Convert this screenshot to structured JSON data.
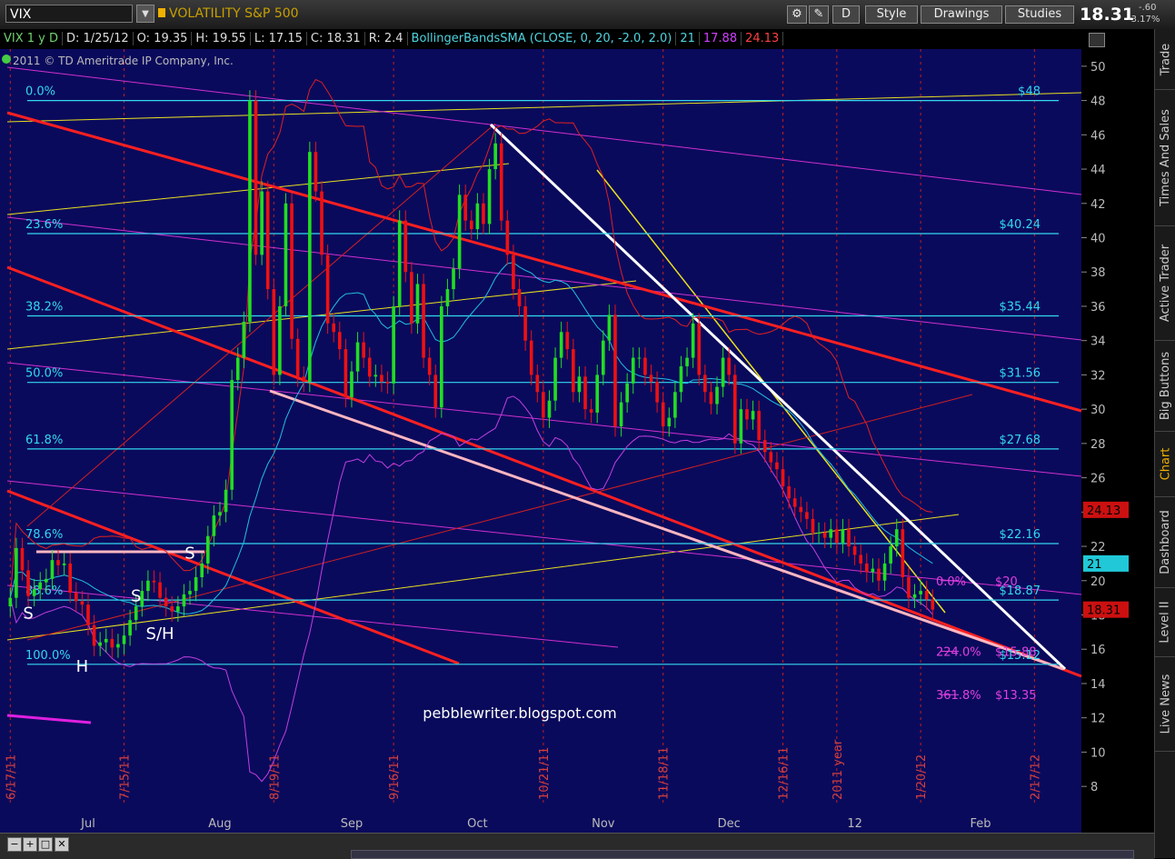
{
  "toolbar": {
    "symbol": "VIX",
    "description": "VOLATILITY S&P 500",
    "aggregation": "D",
    "style_label": "Style",
    "drawings_label": "Drawings",
    "studies_label": "Studies",
    "last_price": "18.31",
    "net_change": "-.60",
    "pct_change": "-3.17%"
  },
  "info": {
    "symbol_period": "VIX 1 y D",
    "date": "D: 1/25/12",
    "open": "O: 19.35",
    "high": "H: 19.55",
    "low": "L: 17.15",
    "close": "C: 18.31",
    "range": "R: 2.4",
    "study": "BollingerBandsSMA (CLOSE, 0, 20, -2.0, 2.0)",
    "mid": "21",
    "lower": "17.88",
    "upper": "24.13"
  },
  "copyright": "2011 © TD Ameritrade IP Company, Inc.",
  "sidebar": [
    "Trade",
    "Times And Sales",
    "Active Trader",
    "Big Buttons",
    "Chart",
    "Dashboard",
    "Level II",
    "Live News"
  ],
  "colors": {
    "background": "#0a0a5c",
    "up_candle": "#22dd22",
    "down_candle": "#ee1111",
    "fib_line": "#33d8ee",
    "red_trend": "#ff2020",
    "white_trend": "#ffffff",
    "pink_trend": "#ffb6c1",
    "magenta": "#d030d0",
    "yellow": "#e8e020",
    "bb_mid": "#20c0e0",
    "bb_upper": "#e02020",
    "bb_lower": "#c040e0"
  },
  "chart_data": {
    "type": "candlestick",
    "title": "VOLATILITY S&P 500",
    "symbol": "VIX",
    "watermark": "pebblewriter.blogspot.com",
    "ylim": [
      7,
      51
    ],
    "y_ticks": [
      8,
      10,
      12,
      14,
      16,
      18,
      20,
      22,
      24,
      26,
      28,
      30,
      32,
      34,
      36,
      38,
      40,
      42,
      44,
      46,
      48,
      50
    ],
    "x_month_labels": [
      {
        "label": "Jul",
        "index": 13
      },
      {
        "label": "Aug",
        "index": 35
      },
      {
        "label": "Sep",
        "index": 57
      },
      {
        "label": "Oct",
        "index": 78
      },
      {
        "label": "Nov",
        "index": 99
      },
      {
        "label": "Dec",
        "index": 120
      },
      {
        "label": "12",
        "index": 141
      },
      {
        "label": "Feb",
        "index": 162
      }
    ],
    "date_markers": [
      {
        "label": "6/17/11",
        "index": 0
      },
      {
        "label": "7/15/11",
        "index": 19
      },
      {
        "label": "8/19/11",
        "index": 44
      },
      {
        "label": "9/16/11",
        "index": 64
      },
      {
        "label": "10/21/11",
        "index": 89
      },
      {
        "label": "11/18/11",
        "index": 109
      },
      {
        "label": "12/16/11",
        "index": 129
      },
      {
        "label": "2011 year",
        "index": 138
      },
      {
        "label": "1/20/12",
        "index": 152
      },
      {
        "label": "2/17/12",
        "index": 171
      }
    ],
    "x_count": 176,
    "candles_close": [
      19.0,
      21.9,
      20.6,
      19.1,
      19.5,
      19.9,
      20.1,
      21.2,
      20.9,
      21.0,
      19.3,
      18.8,
      18.6,
      17.4,
      16.2,
      16.4,
      16.6,
      16.1,
      16.3,
      16.8,
      17.7,
      18.5,
      19.4,
      20.0,
      19.9,
      19.0,
      18.5,
      18.2,
      18.5,
      19.2,
      19.4,
      20.2,
      21.0,
      22.6,
      23.8,
      24.0,
      25.3,
      31.7,
      33.0,
      35.1,
      48.0,
      39.0,
      42.7,
      37.0,
      32.0,
      36.0,
      42.0,
      34.1,
      31.9,
      31.6,
      45.0,
      42.7,
      39.0,
      35.0,
      34.5,
      33.5,
      30.7,
      32.2,
      33.9,
      33.0,
      31.9,
      32.0,
      31.6,
      31.5,
      36.0,
      41.0,
      38.0,
      35.0,
      37.3,
      33.0,
      32.0,
      30.1,
      36.0,
      37.0,
      38.2,
      42.5,
      41.0,
      40.5,
      42.0,
      40.8,
      44.0,
      45.5,
      41.0,
      39.0,
      37.0,
      36.0,
      34.0,
      32.0,
      31.0,
      29.5,
      30.5,
      33.0,
      34.5,
      33.5,
      31.0,
      31.9,
      30.0,
      29.8,
      32.0,
      34.0,
      35.5,
      29.0,
      30.4,
      31.5,
      33.0,
      33.0,
      32.0,
      31.6,
      30.4,
      29.0,
      29.5,
      31.0,
      32.5,
      33.0,
      35.0,
      32.0,
      31.0,
      30.3,
      31.3,
      33.0,
      32.0,
      28.0,
      30.0,
      29.4,
      29.9,
      28.2,
      27.5,
      26.9,
      26.5,
      25.5,
      24.8,
      24.3,
      24.0,
      23.6,
      22.8,
      22.8,
      22.5,
      23.0,
      22.2,
      23.0,
      22.0,
      21.5,
      21.0,
      20.5,
      20.7,
      20.0,
      21.0,
      22.0,
      23.0,
      20.2,
      19.0,
      19.2,
      19.4,
      18.9,
      18.31
    ],
    "fibonacci_retracement": [
      {
        "level": "0.0%",
        "price": 48,
        "label": "$48"
      },
      {
        "level": "23.6%",
        "price": 40.24,
        "label": "$40.24"
      },
      {
        "level": "38.2%",
        "price": 35.44,
        "label": "$35.44"
      },
      {
        "level": "50.0%",
        "price": 31.56,
        "label": "$31.56"
      },
      {
        "level": "61.8%",
        "price": 27.68,
        "label": "$27.68"
      },
      {
        "level": "78.6%",
        "price": 22.16,
        "label": "$22.16"
      },
      {
        "level": "88.6%",
        "price": 18.87,
        "label": "$18.87"
      },
      {
        "level": "100.0%",
        "price": 15.12,
        "label": "$15.12"
      }
    ],
    "fibonacci_extension": [
      {
        "level": "0.0%",
        "price": 20,
        "label": "$20"
      },
      {
        "level": "224.0%",
        "price": 15.88,
        "label": "$15.88"
      },
      {
        "level": "361.8%",
        "price": 13.35,
        "label": "$13.35"
      }
    ],
    "price_flags": [
      {
        "label": "24.13",
        "price": 24.13,
        "color": "#cc1010"
      },
      {
        "label": "21",
        "price": 21.0,
        "color": "#20c8d8"
      },
      {
        "label": "18.31",
        "price": 18.31,
        "color": "#cc1010"
      }
    ],
    "pattern_labels": [
      {
        "text": "S",
        "index": 3,
        "price": 17.8
      },
      {
        "text": "H",
        "index": 12,
        "price": 14.7
      },
      {
        "text": "S",
        "index": 21,
        "price": 18.8
      },
      {
        "text": "S/H",
        "index": 25,
        "price": 16.6
      },
      {
        "text": "S",
        "index": 30,
        "price": 21.3
      }
    ]
  }
}
